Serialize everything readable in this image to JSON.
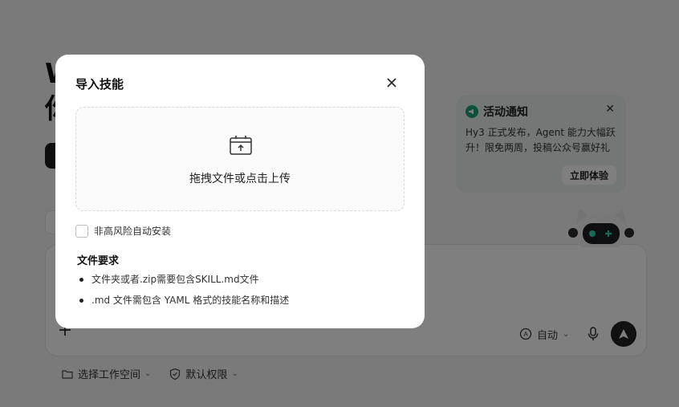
{
  "background": {
    "heading_line1": "W",
    "heading_line2": "你",
    "composer": {
      "add_icon": "plus-icon",
      "mode_label": "自动",
      "mic_icon": "microphone-icon",
      "send_icon": "send-arrow-icon"
    },
    "bottom_bar": {
      "workspace_label": "选择工作空间",
      "permission_label": "默认权限"
    },
    "notice": {
      "title": "活动通知",
      "body": "Hy3 正式发布，Agent 能力大幅跃升！限免两周，投稿公众号赢好礼",
      "button": "立即体验"
    }
  },
  "modal": {
    "title": "导入技能",
    "dropzone_text": "拖拽文件或点击上传",
    "checkbox_label": "非高风险自动安装",
    "checkbox_checked": false,
    "requirements_title": "文件要求",
    "requirements": [
      "文件夹或者.zip需要包含SKILL.md文件",
      ".md 文件需包含 YAML 格式的技能名称和描述"
    ]
  },
  "colors": {
    "overlay": "rgba(0,0,0,0.5)",
    "notice_bg": "#e6eeed",
    "notice_accent": "#1aa37a"
  }
}
